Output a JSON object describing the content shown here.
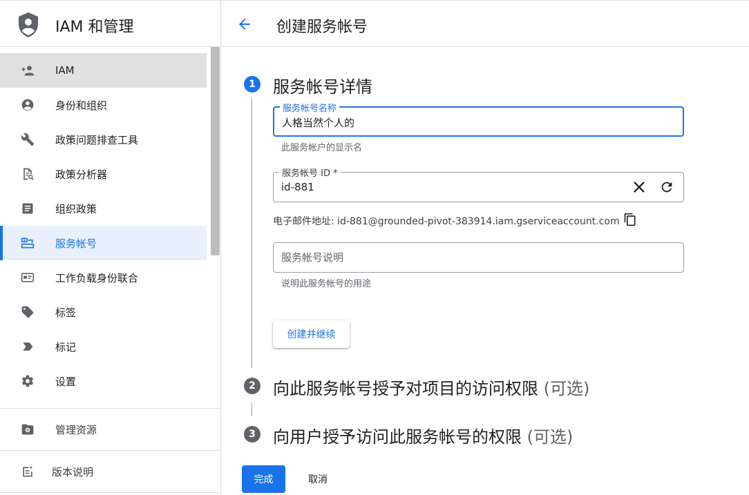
{
  "app": {
    "title": "IAM 和管理"
  },
  "sidebar": {
    "items": [
      {
        "label": "IAM",
        "icon": "person-add-icon"
      },
      {
        "label": "身份和组织",
        "icon": "account-circle-icon"
      },
      {
        "label": "政策问题排查工具",
        "icon": "wrench-icon"
      },
      {
        "label": "政策分析器",
        "icon": "document-search-icon"
      },
      {
        "label": "组织政策",
        "icon": "list-document-icon"
      },
      {
        "label": "服务帐号",
        "icon": "service-account-icon"
      },
      {
        "label": "工作负载身份联合",
        "icon": "id-card-icon"
      },
      {
        "label": "标签",
        "icon": "tag-icon"
      },
      {
        "label": "标记",
        "icon": "label-icon"
      },
      {
        "label": "设置",
        "icon": "gear-icon"
      }
    ],
    "manage_resources": "管理资源",
    "release_notes": "版本说明"
  },
  "page": {
    "title": "创建服务帐号"
  },
  "steps": [
    {
      "number": "1",
      "title": "服务帐号详情",
      "optional": ""
    },
    {
      "number": "2",
      "title": "向此服务帐号授予对项目的访问权限",
      "optional": "(可选)"
    },
    {
      "number": "3",
      "title": "向用户授予访问此服务帐号的权限",
      "optional": "(可选)"
    }
  ],
  "form": {
    "name_label": "服务帐号名称",
    "name_value": "人格当然个人的",
    "name_hint": "此服务帐户的显示名",
    "id_label": "服务帐号 ID *",
    "id_value": "id-881",
    "email_label": "电子邮件地址:",
    "email_value": "id-881@grounded-pivot-383914.iam.gserviceaccount.com",
    "desc_placeholder": "服务帐号说明",
    "desc_hint": "说明此服务帐号的用途",
    "create_button": "创建并继续"
  },
  "footer": {
    "done": "完成",
    "cancel": "取消"
  },
  "colors": {
    "accent": "#1a73e8",
    "step_grey": "#5f6368"
  }
}
